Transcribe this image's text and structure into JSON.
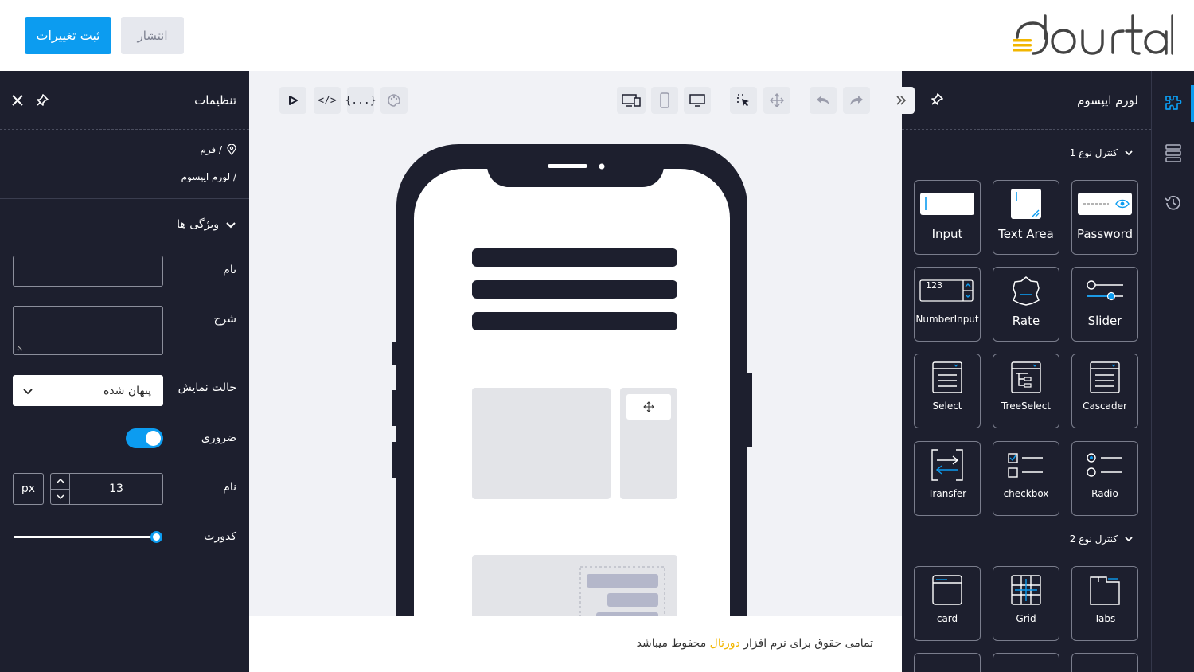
{
  "header": {
    "save_label": "ثبت تغییرات",
    "publish_label": "انتشار",
    "logo_text": "dourtal"
  },
  "settings": {
    "title": "تنظیمات",
    "breadcrumb": [
      "فرم /",
      "لورم ایپسوم /"
    ],
    "section_title": "ویژگی ها",
    "fields": {
      "name_label": "نام",
      "name_value": "",
      "description_label": "شرح",
      "description_value": "",
      "display_mode_label": "حالت نمایش",
      "display_mode_value": "پنهان شده",
      "required_label": "ضروری",
      "required_on": true,
      "size_label": "نام",
      "size_value": "13",
      "size_unit": "px",
      "opacity_label": "کدورت",
      "opacity_value": 1.0
    }
  },
  "canvas": {
    "toolbar": {
      "code_label": "</>",
      "json_label": "{...}"
    }
  },
  "footer": {
    "text_before": "تمامی حقوق برای نرم افزار",
    "brand": "دورتال",
    "text_after": "محفوظ میباشد"
  },
  "components": {
    "title": "لورم ایپسوم",
    "category1": "کنترل نوع 1",
    "category2": "کنترل نوع 2",
    "group1": [
      {
        "label": "Password",
        "icon": "password-icon"
      },
      {
        "label": "Text Area",
        "icon": "textarea-icon"
      },
      {
        "label": "Input",
        "icon": "input-icon"
      },
      {
        "label": "Slider",
        "icon": "slider-icon"
      },
      {
        "label": "Rate",
        "icon": "rate-icon"
      },
      {
        "label": "NumberInput",
        "icon": "number-input-icon"
      },
      {
        "label": "Cascader",
        "icon": "cascader-icon"
      },
      {
        "label": "TreeSelect",
        "icon": "treeselect-icon"
      },
      {
        "label": "Select",
        "icon": "select-icon"
      },
      {
        "label": "Radio",
        "icon": "radio-icon"
      },
      {
        "label": "checkbox",
        "icon": "checkbox-icon"
      },
      {
        "label": "Transfer",
        "icon": "transfer-icon"
      }
    ],
    "group2": [
      {
        "label": "Tabs",
        "icon": "tabs-icon"
      },
      {
        "label": "Grid",
        "icon": "grid-icon"
      },
      {
        "label": "card",
        "icon": "card-icon"
      }
    ],
    "number_input_sample": "123"
  },
  "colors": {
    "accent": "#0c9cf0",
    "panel": "#1d1f2e",
    "brand_yellow": "#f2b600"
  }
}
